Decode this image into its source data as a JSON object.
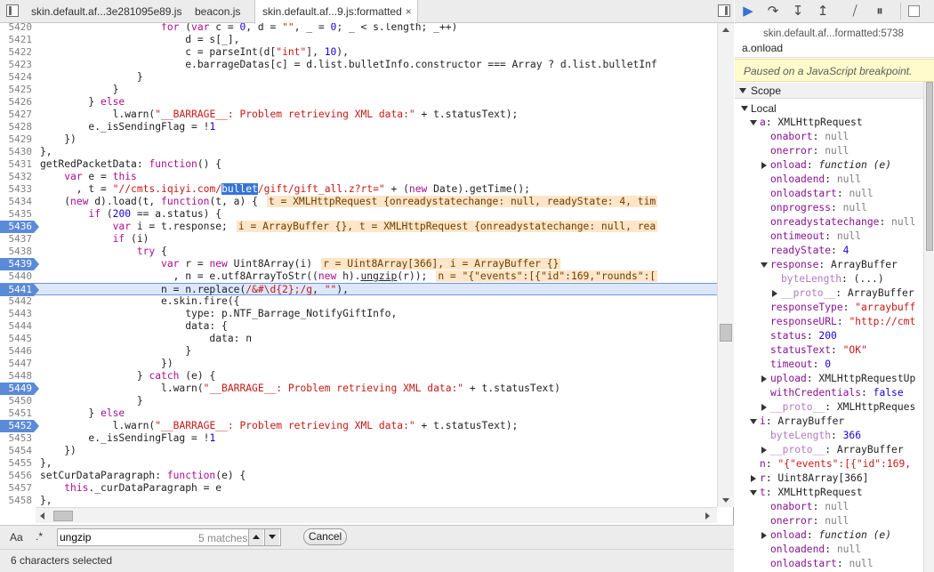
{
  "tabs": [
    {
      "label": "skin.default.af...3e281095e89.js"
    },
    {
      "label": "beacon.js"
    },
    {
      "label": "skin.default.af...9.js:formatted",
      "close": "×"
    }
  ],
  "code_lines": [
    {
      "n": "5420",
      "src": "                    for (var c = 0, d = \"\", _ = 0; _ < s.length; _++)"
    },
    {
      "n": "5421",
      "src": "                        d = s[_],"
    },
    {
      "n": "5422",
      "src": "                        c = parseInt(d[\"int\"], 10),"
    },
    {
      "n": "5423",
      "src": "                        e.barrageDatas[c] = d.list.bulletInfo.constructor === Array ? d.list.bulletInf"
    },
    {
      "n": "5424",
      "src": "                }"
    },
    {
      "n": "5425",
      "src": "            }"
    },
    {
      "n": "5426",
      "src": "        } else"
    },
    {
      "n": "5427",
      "src": "            l.warn(\"__BARRAGE__: Problem retrieving XML data:\" + t.statusText);"
    },
    {
      "n": "5428",
      "src": "        e._isSendingFlag = !1"
    },
    {
      "n": "5429",
      "src": "    })"
    },
    {
      "n": "5430",
      "src": "},"
    },
    {
      "n": "5431",
      "src": "getRedPacketData: function() {"
    },
    {
      "n": "5432",
      "src": "    var e = this"
    },
    {
      "n": "5433",
      "src": "      , t = \"//cmts.iqiyi.com/bullet/gift/gift_all.z?rt=\" + (new Date).getTime();"
    },
    {
      "n": "5434",
      "src": "    (new d).load(t, function(t, a) {",
      "inline": "t = XMLHttpRequest {onreadystatechange: null, readyState: 4, tim"
    },
    {
      "n": "5435",
      "src": "        if (200 == a.status) {"
    },
    {
      "n": "5436",
      "src": "            var i = t.response;",
      "inline": "i = ArrayBuffer {}, t = XMLHttpRequest {onreadystatechange: null, rea",
      "bp": true
    },
    {
      "n": "5437",
      "src": "            if (i)"
    },
    {
      "n": "5438",
      "src": "                try {"
    },
    {
      "n": "5439",
      "src": "                    var r = new Uint8Array(i)",
      "inline": "r = Uint8Array[366], i = ArrayBuffer {}",
      "bp": true
    },
    {
      "n": "5440",
      "src": "                      , n = e.utf8ArrayToStr((new h).ungzip(r));",
      "inline": "n = \"{\"events\":[{\"id\":169,\"rounds\":["
    },
    {
      "n": "5441",
      "src": "                    n = n.replace(/&#\\d{2};/g, \"\"),",
      "bp": true,
      "exec": true
    },
    {
      "n": "5442",
      "src": "                    e.skin.fire({"
    },
    {
      "n": "5443",
      "src": "                        type: p.NTF_Barrage_NotifyGiftInfo,"
    },
    {
      "n": "5444",
      "src": "                        data: {"
    },
    {
      "n": "5445",
      "src": "                            data: n"
    },
    {
      "n": "5446",
      "src": "                        }"
    },
    {
      "n": "5447",
      "src": "                    })"
    },
    {
      "n": "5448",
      "src": "                } catch (e) {"
    },
    {
      "n": "5449",
      "src": "                    l.warn(\"__BARRAGE__: Problem retrieving XML data:\" + t.statusText)",
      "bp": true
    },
    {
      "n": "5450",
      "src": "                }"
    },
    {
      "n": "5451",
      "src": "        } else"
    },
    {
      "n": "5452",
      "src": "            l.warn(\"__BARRAGE__: Problem retrieving XML data:\" + t.statusText);",
      "bp": true
    },
    {
      "n": "5453",
      "src": "        e._isSendingFlag = !1"
    },
    {
      "n": "5454",
      "src": "    })"
    },
    {
      "n": "5455",
      "src": "},"
    },
    {
      "n": "5456",
      "src": "setCurDataParagraph: function(e) {"
    },
    {
      "n": "5457",
      "src": "    this._curDataParagraph = e"
    },
    {
      "n": "5458",
      "src": "},"
    },
    {
      "n": "5459",
      "src": ""
    }
  ],
  "search": {
    "case_label": "Aa",
    "regex_label": ".*",
    "query": "ungzip",
    "matches": "5 matches",
    "cancel_label": "Cancel"
  },
  "status": {
    "text": "6 characters selected"
  },
  "debugger": {
    "call_frame_location": "skin.default.af...formatted:5738",
    "call_frame_name": "a.onload",
    "paused_message": "Paused on a JavaScript breakpoint.",
    "scope_title": "Scope",
    "local_label": "Local",
    "scope_rows": [
      {
        "d": 1,
        "tri": "open",
        "name": "a",
        "val": "XMLHttpRequest",
        "vt": "val"
      },
      {
        "d": 2,
        "name": "onabort",
        "val": "null",
        "vt": "null"
      },
      {
        "d": 2,
        "name": "onerror",
        "val": "null",
        "vt": "null"
      },
      {
        "d": 2,
        "tri": "closed",
        "name": "onload",
        "val": "function (e)",
        "vt": "fn"
      },
      {
        "d": 2,
        "name": "onloadend",
        "val": "null",
        "vt": "null"
      },
      {
        "d": 2,
        "name": "onloadstart",
        "val": "null",
        "vt": "null"
      },
      {
        "d": 2,
        "name": "onprogress",
        "val": "null",
        "vt": "null"
      },
      {
        "d": 2,
        "name": "onreadystatechange",
        "val": "null",
        "vt": "null"
      },
      {
        "d": 2,
        "name": "ontimeout",
        "val": "null",
        "vt": "null"
      },
      {
        "d": 2,
        "name": "readyState",
        "val": "4",
        "vt": "num"
      },
      {
        "d": 2,
        "tri": "open",
        "name": "response",
        "val": "ArrayBuffer",
        "vt": "val"
      },
      {
        "d": 3,
        "name": "byteLength",
        "val": "(...)",
        "vt": "val",
        "dim": true
      },
      {
        "d": 3,
        "tri": "closed",
        "name": "__proto__",
        "val": "ArrayBuffer",
        "vt": "val",
        "dim": true
      },
      {
        "d": 2,
        "name": "responseType",
        "val": "\"arraybuff",
        "vt": "str"
      },
      {
        "d": 2,
        "name": "responseURL",
        "val": "\"http://cmt",
        "vt": "str"
      },
      {
        "d": 2,
        "name": "status",
        "val": "200",
        "vt": "num"
      },
      {
        "d": 2,
        "name": "statusText",
        "val": "\"OK\"",
        "vt": "str"
      },
      {
        "d": 2,
        "name": "timeout",
        "val": "0",
        "vt": "num"
      },
      {
        "d": 2,
        "tri": "closed",
        "name": "upload",
        "val": "XMLHttpRequestUp",
        "vt": "val"
      },
      {
        "d": 2,
        "name": "withCredentials",
        "val": "false",
        "vt": "kw"
      },
      {
        "d": 2,
        "tri": "closed",
        "name": "__proto__",
        "val": "XMLHttpReques",
        "vt": "val",
        "dim": true
      },
      {
        "d": 1,
        "tri": "open",
        "name": "i",
        "val": "ArrayBuffer",
        "vt": "val"
      },
      {
        "d": 2,
        "name": "byteLength",
        "val": "366",
        "vt": "num",
        "dim": true
      },
      {
        "d": 2,
        "tri": "closed",
        "name": "__proto__",
        "val": "ArrayBuffer",
        "vt": "val",
        "dim": true
      },
      {
        "d": 1,
        "name": "n",
        "val": "\"{\"events\":[{\"id\":169,",
        "vt": "str"
      },
      {
        "d": 1,
        "tri": "closed",
        "name": "r",
        "val": "Uint8Array[366]",
        "vt": "val"
      },
      {
        "d": 1,
        "tri": "open",
        "name": "t",
        "val": "XMLHttpRequest",
        "vt": "val"
      },
      {
        "d": 2,
        "name": "onabort",
        "val": "null",
        "vt": "null"
      },
      {
        "d": 2,
        "name": "onerror",
        "val": "null",
        "vt": "null"
      },
      {
        "d": 2,
        "tri": "closed",
        "name": "onload",
        "val": "function (e)",
        "vt": "fn"
      },
      {
        "d": 2,
        "name": "onloadend",
        "val": "null",
        "vt": "null"
      },
      {
        "d": 2,
        "name": "onloadstart",
        "val": "null",
        "vt": "null"
      }
    ]
  },
  "colors": {
    "breakpoint": "#5b8ad8",
    "exec_line": "#dce7fa",
    "search_highlight": "#3875d7",
    "inline_value_bg": "#fde6c8",
    "paused_bg": "#fffbcc"
  }
}
